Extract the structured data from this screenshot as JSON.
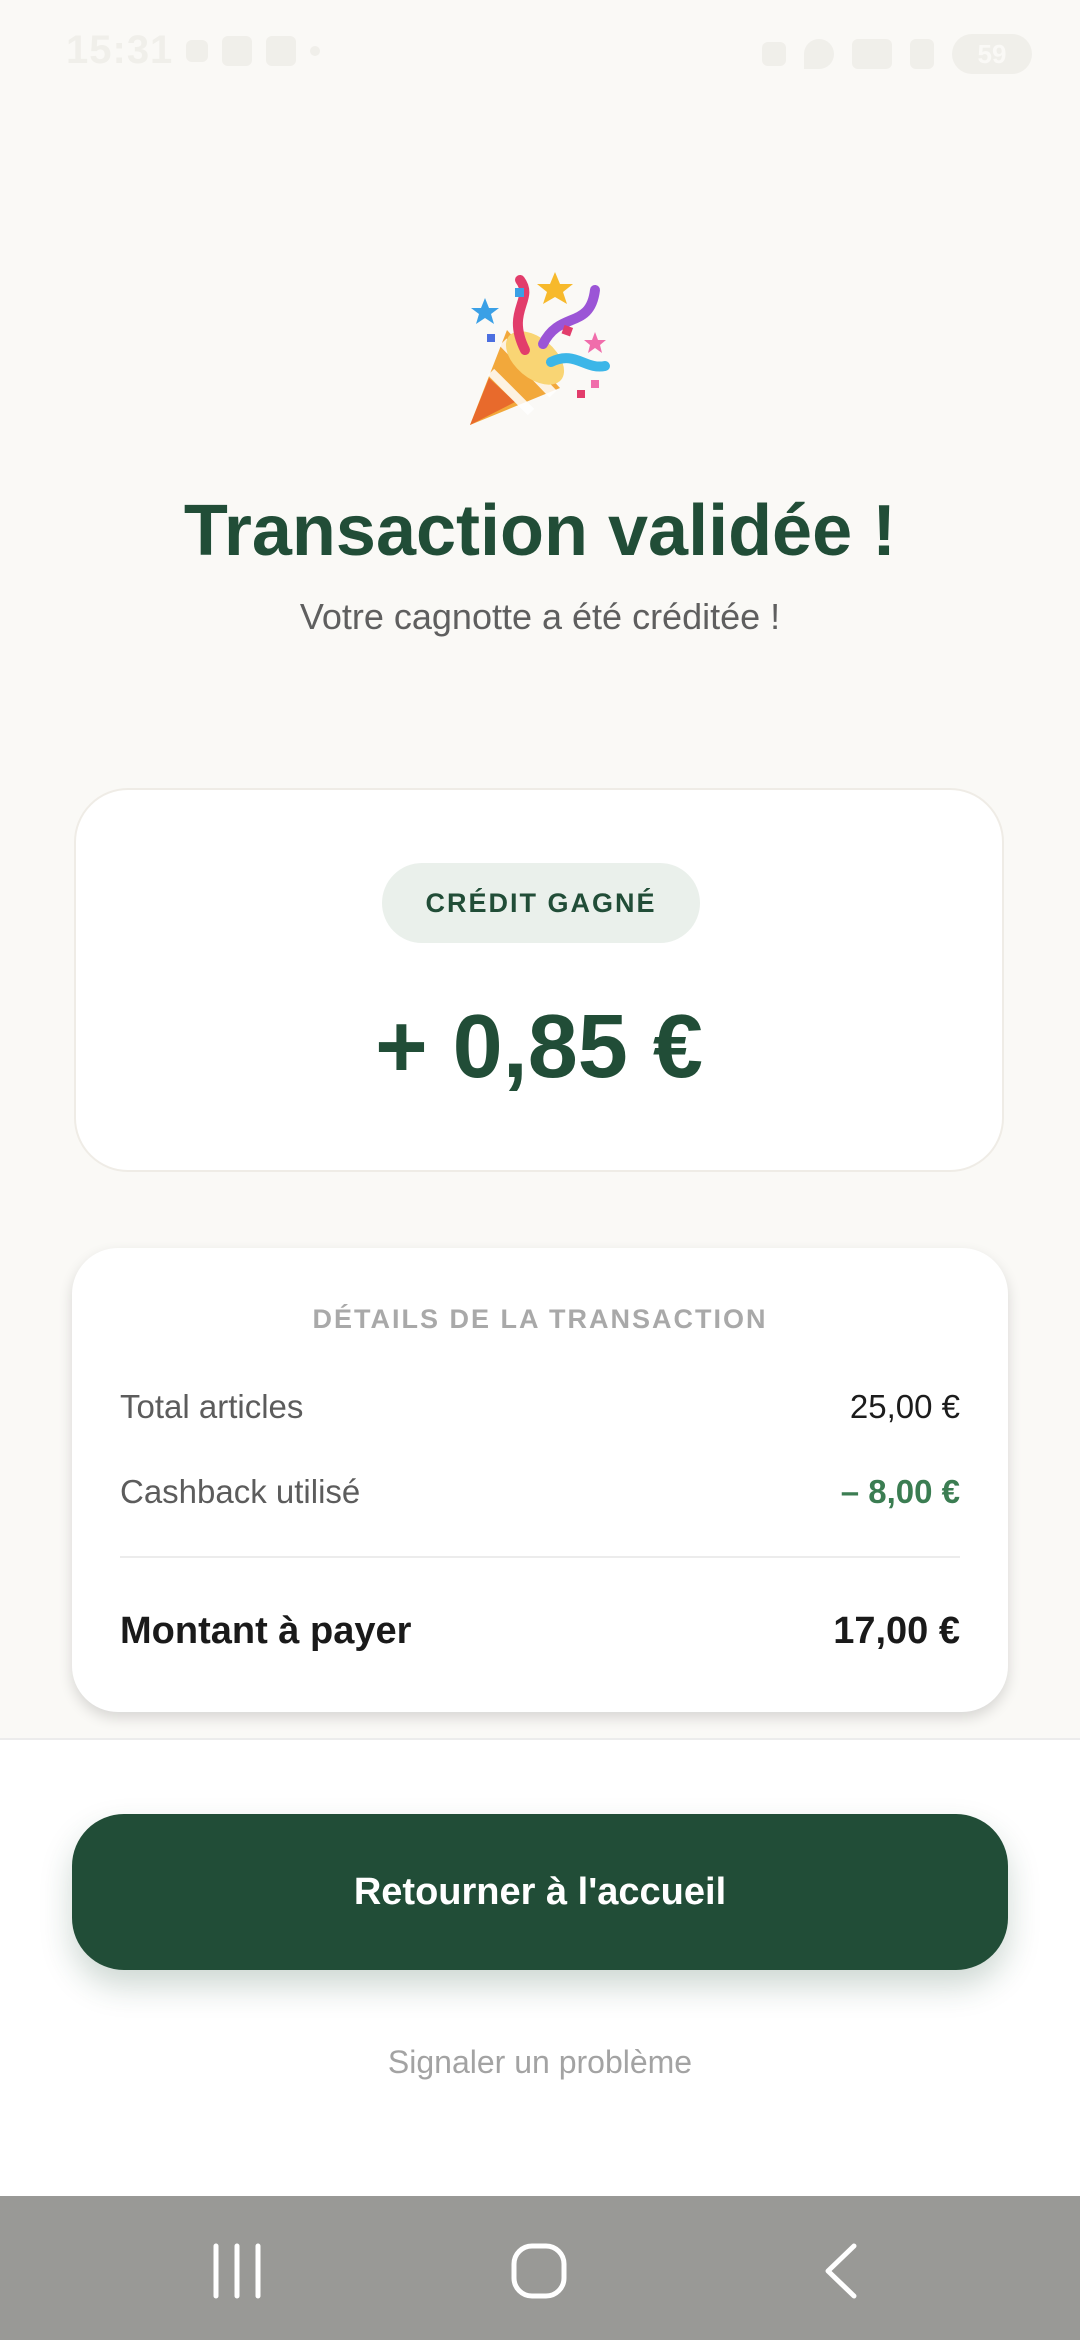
{
  "status_bar": {
    "time": "15:31",
    "battery": "59"
  },
  "hero": {
    "icon": "party-popper-icon",
    "title": "Transaction validée !",
    "subtitle": "Votre cagnotte a été créditée !"
  },
  "credit": {
    "badge": "CRÉDIT GAGNÉ",
    "amount": "+ 0,85 €"
  },
  "details": {
    "title": "DÉTAILS DE LA TRANSACTION",
    "rows": [
      {
        "label": "Total articles",
        "value": "25,00 €"
      },
      {
        "label": "Cashback utilisé",
        "value": "– 8,00 €"
      }
    ],
    "total": {
      "label": "Montant à payer",
      "value": "17,00 €"
    }
  },
  "actions": {
    "home_button": "Retourner à l'accueil",
    "report_link": "Signaler un problème"
  },
  "nav": {
    "recent": "recent-apps-icon",
    "home": "home-icon",
    "back": "back-icon"
  },
  "colors": {
    "primary": "#214d37",
    "accent_green": "#3b7d52",
    "background": "#faf9f6"
  }
}
